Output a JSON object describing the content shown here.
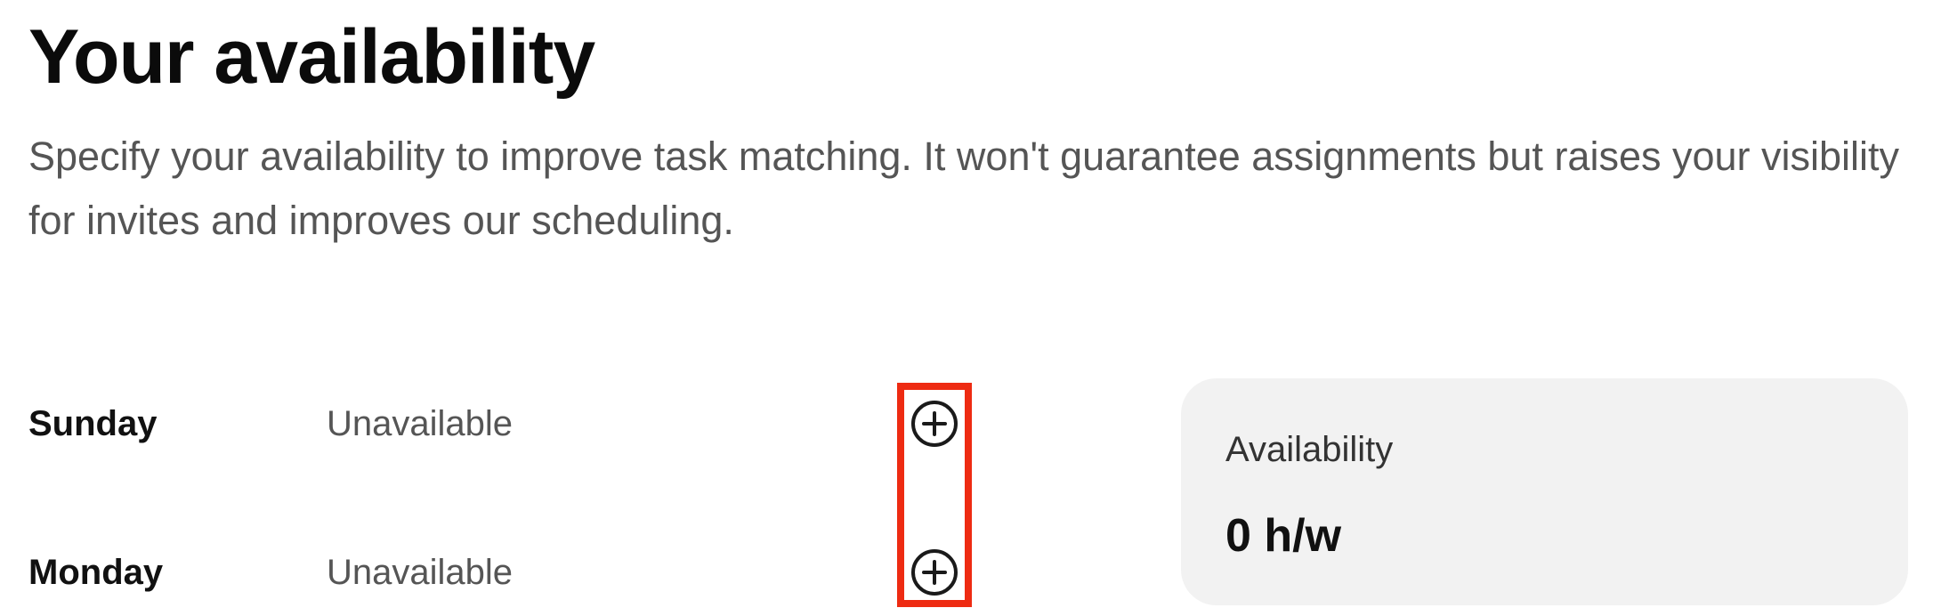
{
  "page": {
    "title": "Your availability",
    "description": "Specify your availability to improve task matching. It won't guarantee assignments but raises your visibility for invites and improves our scheduling."
  },
  "days": [
    {
      "name": "Sunday",
      "status": "Unavailable",
      "add_icon": "plus-circle-icon"
    },
    {
      "name": "Monday",
      "status": "Unavailable",
      "add_icon": "plus-circle-icon"
    }
  ],
  "summary": {
    "label": "Availability",
    "value": "0 h/w"
  },
  "colors": {
    "highlight": "#ee2b12",
    "card_background": "#f2f2f2",
    "muted_text": "#555555"
  }
}
